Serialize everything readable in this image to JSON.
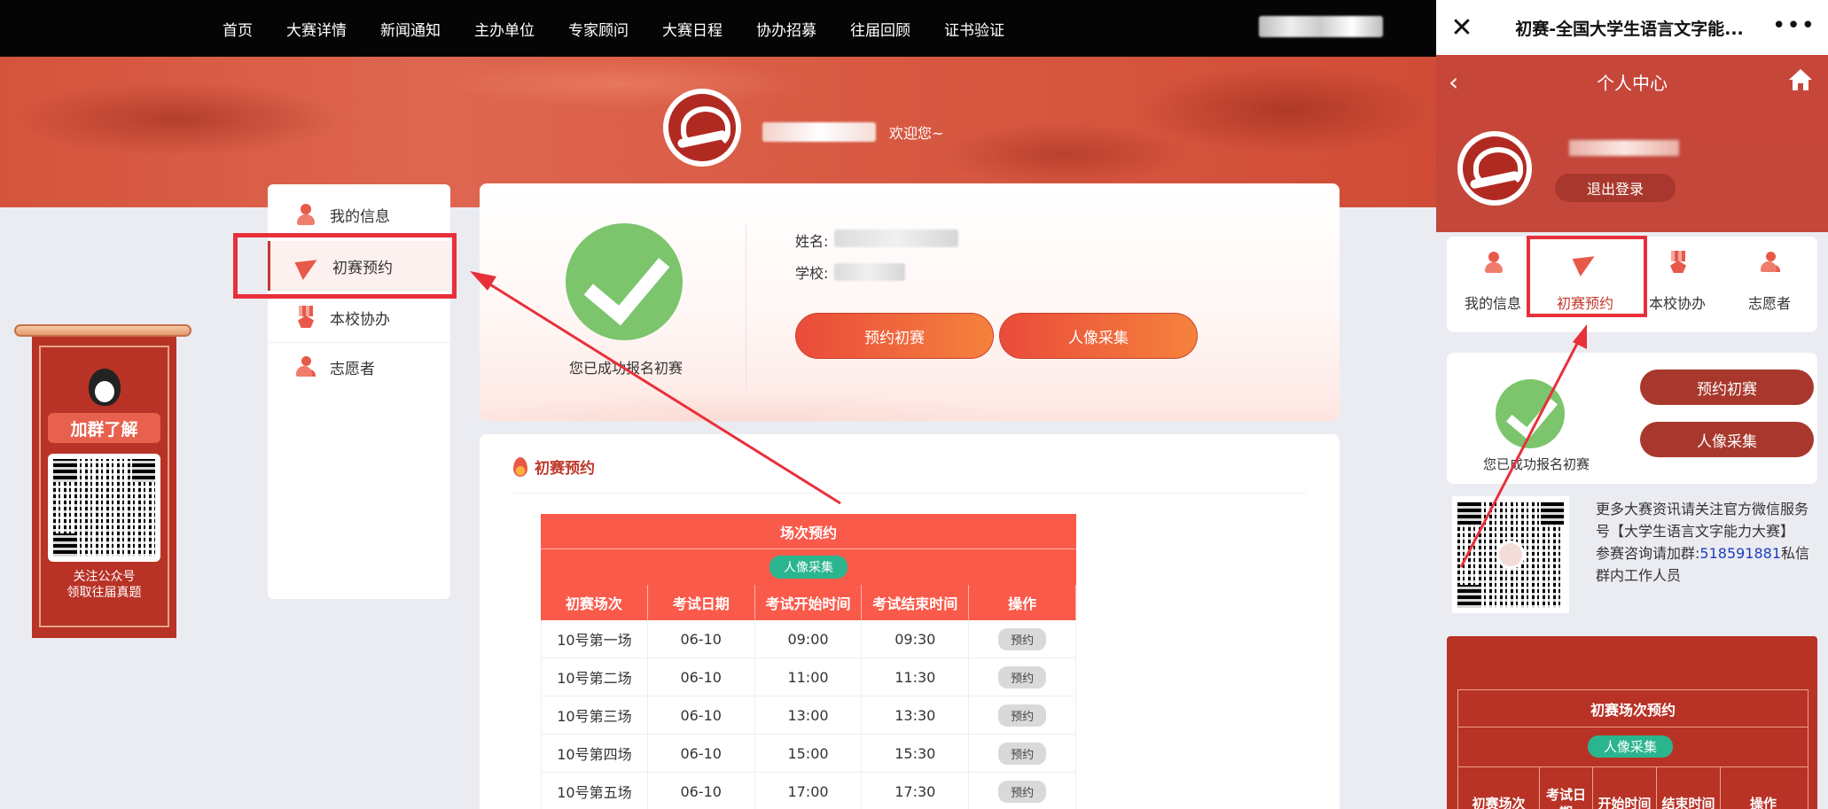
{
  "nav": {
    "items": [
      "首页",
      "大赛详情",
      "新闻通知",
      "主办单位",
      "专家顾问",
      "大赛日程",
      "协办招募",
      "往届回顾",
      "证书验证"
    ]
  },
  "banner": {
    "welcome": "欢迎您~"
  },
  "side_menu": {
    "items": [
      {
        "label": "我的信息",
        "icon": "person-icon"
      },
      {
        "label": "初赛预约",
        "icon": "paper-plane-icon"
      },
      {
        "label": "本校协办",
        "icon": "medal-icon"
      },
      {
        "label": "志愿者",
        "icon": "volunteer-icon"
      }
    ],
    "active_index": 1
  },
  "status": {
    "message": "您已成功报名初赛",
    "name_label": "姓名:",
    "school_label": "学校:",
    "btn_reserve": "预约初赛",
    "btn_photo": "人像采集"
  },
  "reservation": {
    "title": "初赛预约",
    "table_title": "场次预约",
    "photo_pill": "人像采集",
    "columns": [
      "初赛场次",
      "考试日期",
      "考试开始时间",
      "考试结束时间",
      "操作"
    ],
    "rows": [
      {
        "session": "10号第一场",
        "date": "06-10",
        "start": "09:00",
        "end": "09:30",
        "action": "预约"
      },
      {
        "session": "10号第二场",
        "date": "06-10",
        "start": "11:00",
        "end": "11:30",
        "action": "预约"
      },
      {
        "session": "10号第三场",
        "date": "06-10",
        "start": "13:00",
        "end": "13:30",
        "action": "预约"
      },
      {
        "session": "10号第四场",
        "date": "06-10",
        "start": "15:00",
        "end": "15:30",
        "action": "预约"
      },
      {
        "session": "10号第五场",
        "date": "06-10",
        "start": "17:00",
        "end": "17:30",
        "action": "预约"
      }
    ]
  },
  "qq_banner": {
    "join": "加群了解",
    "caption_line1": "关注公众号",
    "caption_line2": "领取往届真题"
  },
  "mobile": {
    "window_title": "初赛-全国大学生语言文字能...",
    "page_title": "个人中心",
    "logout": "退出登录",
    "tabs": [
      {
        "label": "我的信息",
        "icon": "person-icon"
      },
      {
        "label": "初赛预约",
        "icon": "paper-plane-icon"
      },
      {
        "label": "本校协办",
        "icon": "medal-icon"
      },
      {
        "label": "志愿者",
        "icon": "volunteer-icon"
      }
    ],
    "active_tab": 1,
    "status_text": "您已成功报名初赛",
    "btn_reserve": "预约初赛",
    "btn_photo": "人像采集",
    "info_line1": "更多大赛资讯请关注官方微信服务号【大学生语言文字能力大赛】",
    "info_line2_prefix": "参赛咨询请加群:",
    "info_group": "518591881",
    "info_line2_suffix": "私信群内工作人员",
    "resv_title": "初赛场次预约",
    "resv_pill": "人像采集",
    "resv_columns": [
      "初赛场次",
      "考试日期",
      "开始时间",
      "结束时间",
      "操作"
    ]
  },
  "colors": {
    "accent_red": "#c0392b",
    "table_red": "#fa5a4a",
    "success_green": "#7cc56d",
    "pill_green": "#2bb58e",
    "highlight_box": "#e8303a"
  }
}
